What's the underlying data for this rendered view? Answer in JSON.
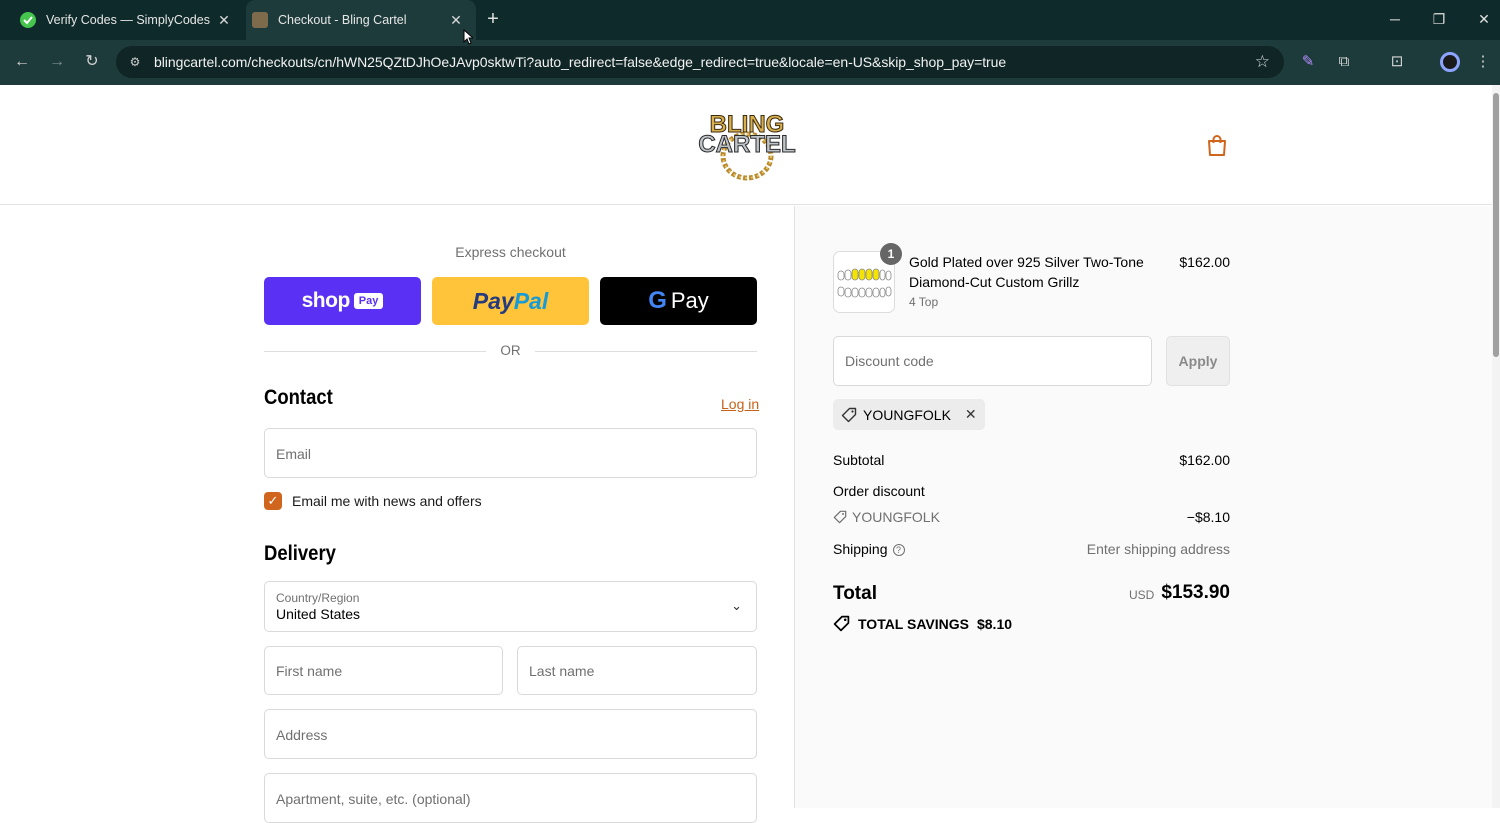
{
  "browser": {
    "tabs": [
      {
        "title": "Verify Codes — SimplyCodes",
        "active": false
      },
      {
        "title": "Checkout - Bling Cartel",
        "active": true
      }
    ],
    "url": "blingcartel.com/checkouts/cn/hWN25QZtDJhOeJAvp0sktwTi?auto_redirect=false&edge_redirect=true&locale=en-US&skip_shop_pay=true"
  },
  "header": {
    "logo_alt": "BLING CARTEL"
  },
  "express": {
    "title": "Express checkout",
    "shop_pay_word": "shop",
    "shop_pay_pill": "Pay",
    "paypal_pay": "Pay",
    "paypal_pal": "Pal",
    "gpay_g": "G",
    "gpay_pay": "Pay",
    "or": "OR"
  },
  "contact": {
    "title": "Contact",
    "login": "Log in",
    "email_placeholder": "Email",
    "newsletter_label": "Email me with news and offers",
    "newsletter_checked": true
  },
  "delivery": {
    "title": "Delivery",
    "country_label": "Country/Region",
    "country_value": "United States",
    "first_name_placeholder": "First name",
    "last_name_placeholder": "Last name",
    "address_placeholder": "Address",
    "apartment_placeholder": "Apartment, suite, etc. (optional)"
  },
  "summary": {
    "product": {
      "quantity": "1",
      "name": "Gold Plated over 925 Silver Two-Tone Diamond-Cut Custom Grillz",
      "variant": "4 Top",
      "price": "$162.00"
    },
    "discount_placeholder": "Discount code",
    "apply": "Apply",
    "applied_code": "YOUNGFOLK",
    "subtotal_label": "Subtotal",
    "subtotal_value": "$162.00",
    "order_discount_label": "Order discount",
    "discount_code": "YOUNGFOLK",
    "discount_value": "−$8.10",
    "shipping_label": "Shipping",
    "shipping_value": "Enter shipping address",
    "total_label": "Total",
    "currency": "USD",
    "total_value": "$153.90",
    "savings_label": "TOTAL SAVINGS",
    "savings_value": "$8.10"
  },
  "colors": {
    "accent": "#d0661e",
    "link": "#c5631b",
    "shop_pay": "#5a31f4",
    "paypal": "#ffc439"
  }
}
